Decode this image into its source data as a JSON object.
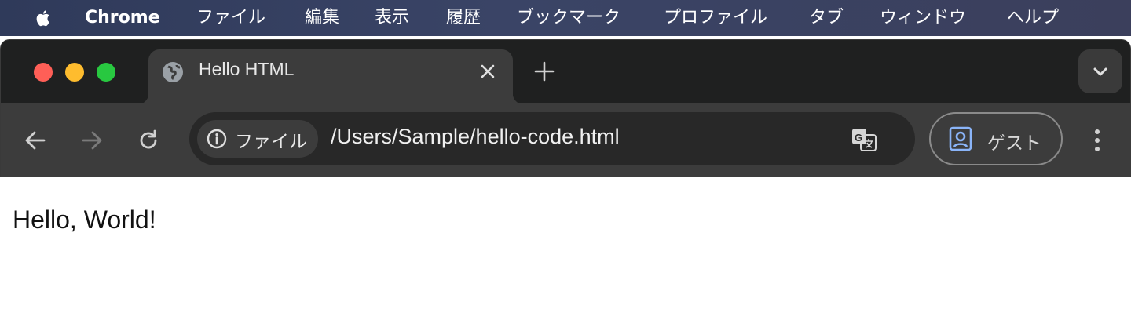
{
  "menubar": {
    "app_name": "Chrome",
    "items": [
      "ファイル",
      "編集",
      "表示",
      "履歴",
      "ブックマーク",
      "プロファイル",
      "タブ",
      "ウィンドウ",
      "ヘルプ"
    ]
  },
  "tab": {
    "title": "Hello HTML",
    "favicon": "globe-icon"
  },
  "toolbar": {
    "back_icon": "back-arrow-icon",
    "forward_icon": "forward-arrow-icon",
    "reload_icon": "reload-icon",
    "site_info_label": "ファイル",
    "url": "/Users/Sample/hello-code.html",
    "translate_icon": "translate-icon",
    "profile_label": "ゲスト",
    "menu_icon": "more-vert-icon"
  },
  "page": {
    "text": "Hello, World!"
  },
  "colors": {
    "close_red": "#ff5f57",
    "minimize_yellow": "#febc2e",
    "zoom_green": "#28c840",
    "toolbar_bg": "#3c3c3c",
    "omnibox_bg": "#282828"
  }
}
